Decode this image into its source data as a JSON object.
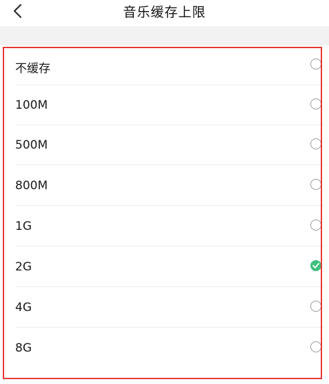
{
  "header": {
    "title": "音乐缓存上限"
  },
  "options": [
    {
      "label": "不缓存",
      "selected": false
    },
    {
      "label": "100M",
      "selected": false
    },
    {
      "label": "500M",
      "selected": false
    },
    {
      "label": "800M",
      "selected": false
    },
    {
      "label": "1G",
      "selected": false
    },
    {
      "label": "2G",
      "selected": true
    },
    {
      "label": "4G",
      "selected": false
    },
    {
      "label": "8G",
      "selected": false
    }
  ],
  "colors": {
    "selected_radio": "#3fbf7f",
    "highlight_frame": "#e53935"
  },
  "icons": {
    "back": "chevron-left-icon",
    "selected": "check-circle-icon",
    "unselected": "radio-empty-icon"
  }
}
